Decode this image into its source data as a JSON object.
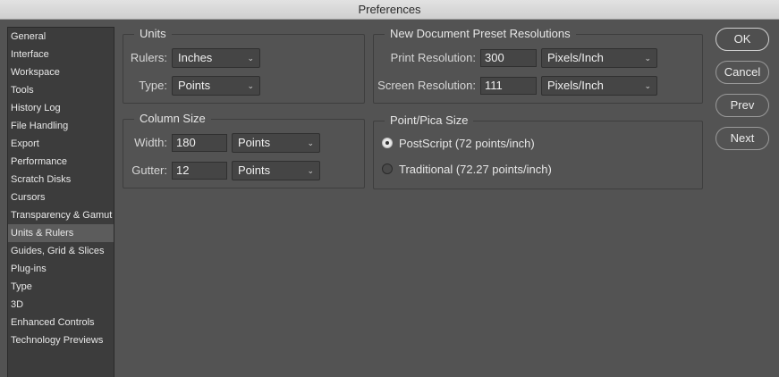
{
  "window": {
    "title": "Preferences"
  },
  "sidebar": {
    "items": [
      {
        "label": "General"
      },
      {
        "label": "Interface"
      },
      {
        "label": "Workspace"
      },
      {
        "label": "Tools"
      },
      {
        "label": "History Log"
      },
      {
        "label": "File Handling"
      },
      {
        "label": "Export"
      },
      {
        "label": "Performance"
      },
      {
        "label": "Scratch Disks"
      },
      {
        "label": "Cursors"
      },
      {
        "label": "Transparency & Gamut"
      },
      {
        "label": "Units & Rulers"
      },
      {
        "label": "Guides, Grid & Slices"
      },
      {
        "label": "Plug-ins"
      },
      {
        "label": "Type"
      },
      {
        "label": "3D"
      },
      {
        "label": "Enhanced Controls"
      },
      {
        "label": "Technology Previews"
      }
    ],
    "selected": "Units & Rulers"
  },
  "units": {
    "title": "Units",
    "rulers_label": "Rulers:",
    "rulers_value": "Inches",
    "type_label": "Type:",
    "type_value": "Points"
  },
  "column_size": {
    "title": "Column Size",
    "width_label": "Width:",
    "width_value": "180",
    "width_unit": "Points",
    "gutter_label": "Gutter:",
    "gutter_value": "12",
    "gutter_unit": "Points"
  },
  "preset_resolutions": {
    "title": "New Document Preset Resolutions",
    "print_label": "Print Resolution:",
    "print_value": "300",
    "print_unit": "Pixels/Inch",
    "screen_label": "Screen Resolution:",
    "screen_value": "111",
    "screen_unit": "Pixels/Inch"
  },
  "point_pica": {
    "title": "Point/Pica Size",
    "postscript_label": "PostScript (72 points/inch)",
    "traditional_label": "Traditional (72.27 points/inch)",
    "selected": "PostScript (72 points/inch)"
  },
  "buttons": {
    "ok": "OK",
    "cancel": "Cancel",
    "prev": "Prev",
    "next": "Next"
  }
}
